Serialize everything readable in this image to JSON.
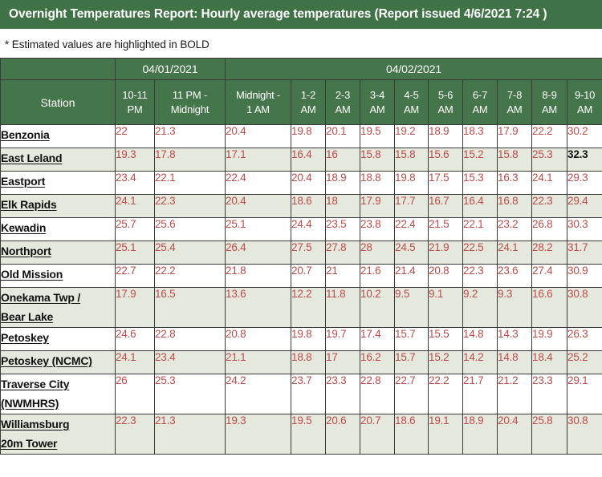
{
  "banner": {
    "title": "Overnight Temperatures Report: Hourly average temperatures (Report issued 4/6/2021 7:24 )"
  },
  "note": {
    "text": "* Estimated values are highlighted in BOLD"
  },
  "colors": {
    "banner_green": "#3f7245",
    "header_green": "#45754a",
    "value_red": "#bf4a47",
    "estimated_black": "#111111",
    "row_alt": "#e5e9dd",
    "row_base": "#ffffff",
    "border": "#3a3a3a"
  },
  "table": {
    "date_groups": [
      {
        "label": "",
        "span": 1
      },
      {
        "label": "04/01/2021",
        "span": 2
      },
      {
        "label": "04/02/2021",
        "span": 10
      }
    ],
    "columns": [
      "Station",
      "10-11 PM",
      "11 PM - Midnight",
      "Midnight - 1 AM",
      "1-2 AM",
      "2-3 AM",
      "3-4 AM",
      "4-5 AM",
      "5-6 AM",
      "6-7 AM",
      "7-8 AM",
      "8-9 AM",
      "9-10 AM"
    ],
    "column_lines": [
      [
        "Station",
        ""
      ],
      [
        "10-11",
        "PM"
      ],
      [
        "11 PM -",
        "Midnight"
      ],
      [
        "Midnight -",
        "1 AM"
      ],
      [
        "1-2",
        "AM"
      ],
      [
        "2-3",
        "AM"
      ],
      [
        "3-4",
        "AM"
      ],
      [
        "4-5",
        "AM"
      ],
      [
        "5-6",
        "AM"
      ],
      [
        "6-7",
        "AM"
      ],
      [
        "7-8",
        "AM"
      ],
      [
        "8-9",
        "AM"
      ],
      [
        "9-10",
        "AM"
      ]
    ],
    "rows": [
      {
        "station": "Benzonia",
        "station_lines": [
          "Benzonia"
        ],
        "values": [
          "22",
          "21.3",
          "20.4",
          "19.8",
          "20.1",
          "19.5",
          "19.2",
          "18.9",
          "18.3",
          "17.9",
          "22.2",
          "30.2"
        ],
        "estimated": [
          false,
          false,
          false,
          false,
          false,
          false,
          false,
          false,
          false,
          false,
          false,
          false
        ]
      },
      {
        "station": "East Leland",
        "station_lines": [
          "East Leland"
        ],
        "values": [
          "19.3",
          "17.8",
          "17.1",
          "16.4",
          "16",
          "15.8",
          "15.8",
          "15.6",
          "15.2",
          "15.8",
          "25.3",
          "32.3"
        ],
        "estimated": [
          false,
          false,
          false,
          false,
          false,
          false,
          false,
          false,
          false,
          false,
          false,
          true
        ]
      },
      {
        "station": "Eastport",
        "station_lines": [
          "Eastport"
        ],
        "values": [
          "23.4",
          "22.1",
          "22.4",
          "20.4",
          "18.9",
          "18.8",
          "19.8",
          "17.5",
          "15.3",
          "16.3",
          "24.1",
          "29.3"
        ],
        "estimated": [
          false,
          false,
          false,
          false,
          false,
          false,
          false,
          false,
          false,
          false,
          false,
          false
        ]
      },
      {
        "station": "Elk Rapids",
        "station_lines": [
          "Elk Rapids"
        ],
        "values": [
          "24.1",
          "22.3",
          "20.4",
          "18.6",
          "18",
          "17.9",
          "17.7",
          "16.7",
          "16.4",
          "16.8",
          "22.3",
          "29.4"
        ],
        "estimated": [
          false,
          false,
          false,
          false,
          false,
          false,
          false,
          false,
          false,
          false,
          false,
          false
        ]
      },
      {
        "station": "Kewadin",
        "station_lines": [
          "Kewadin"
        ],
        "values": [
          "25.7",
          "25.6",
          "25.1",
          "24.4",
          "23.5",
          "23.8",
          "22.4",
          "21.5",
          "22.1",
          "23.2",
          "26.8",
          "30.3"
        ],
        "estimated": [
          false,
          false,
          false,
          false,
          false,
          false,
          false,
          false,
          false,
          false,
          false,
          false
        ]
      },
      {
        "station": "Northport",
        "station_lines": [
          "Northport"
        ],
        "values": [
          "25.1",
          "25.4",
          "26.4",
          "27.5",
          "27.8",
          "28",
          "24.5",
          "21.9",
          "22.5",
          "24.1",
          "28.2",
          "31.7"
        ],
        "estimated": [
          false,
          false,
          false,
          false,
          false,
          false,
          false,
          false,
          false,
          false,
          false,
          false
        ]
      },
      {
        "station": "Old Mission",
        "station_lines": [
          "Old Mission"
        ],
        "values": [
          "22.7",
          "22.2",
          "21.8",
          "20.7",
          "21",
          "21.6",
          "21.4",
          "20.8",
          "22.3",
          "23.6",
          "27.4",
          "30.9"
        ],
        "estimated": [
          false,
          false,
          false,
          false,
          false,
          false,
          false,
          false,
          false,
          false,
          false,
          false
        ]
      },
      {
        "station": "Onekama Twp / Bear Lake",
        "station_lines": [
          "Onekama Twp /",
          "Bear Lake"
        ],
        "values": [
          "17.9",
          "16.5",
          "13.6",
          "12.2",
          "11.8",
          "10.2",
          "9.5",
          "9.1",
          "9.2",
          "9.3",
          "16.6",
          "30.8"
        ],
        "estimated": [
          false,
          false,
          false,
          false,
          false,
          false,
          false,
          false,
          false,
          false,
          false,
          false
        ]
      },
      {
        "station": "Petoskey",
        "station_lines": [
          "Petoskey"
        ],
        "values": [
          "24.6",
          "22.8",
          "20.8",
          "19.8",
          "19.7",
          "17.4",
          "15.7",
          "15.5",
          "14.8",
          "14.3",
          "19.9",
          "26.3"
        ],
        "estimated": [
          false,
          false,
          false,
          false,
          false,
          false,
          false,
          false,
          false,
          false,
          false,
          false
        ]
      },
      {
        "station": "Petoskey (NCMC)",
        "station_lines": [
          "Petoskey (NCMC)"
        ],
        "values": [
          "24.1",
          "23.4",
          "21.1",
          "18.8",
          "17",
          "16.2",
          "15.7",
          "15.2",
          "14.2",
          "14.8",
          "18.4",
          "25.2"
        ],
        "estimated": [
          false,
          false,
          false,
          false,
          false,
          false,
          false,
          false,
          false,
          false,
          false,
          false
        ]
      },
      {
        "station": "Traverse City (NWMHRS)",
        "station_lines": [
          "Traverse City",
          "(NWMHRS)"
        ],
        "values": [
          "26",
          "25.3",
          "24.2",
          "23.7",
          "23.3",
          "22.8",
          "22.7",
          "22.2",
          "21.7",
          "21.2",
          "23.3",
          "29.1"
        ],
        "estimated": [
          false,
          false,
          false,
          false,
          false,
          false,
          false,
          false,
          false,
          false,
          false,
          false
        ]
      },
      {
        "station": "Williamsburg 20m Tower",
        "station_lines": [
          "Williamsburg",
          "20m Tower"
        ],
        "values": [
          "22.3",
          "21.3",
          "19.3",
          "19.5",
          "20.6",
          "20.7",
          "18.6",
          "19.1",
          "18.9",
          "20.4",
          "25.8",
          "30.8"
        ],
        "estimated": [
          false,
          false,
          false,
          false,
          false,
          false,
          false,
          false,
          false,
          false,
          false,
          false
        ]
      }
    ]
  }
}
